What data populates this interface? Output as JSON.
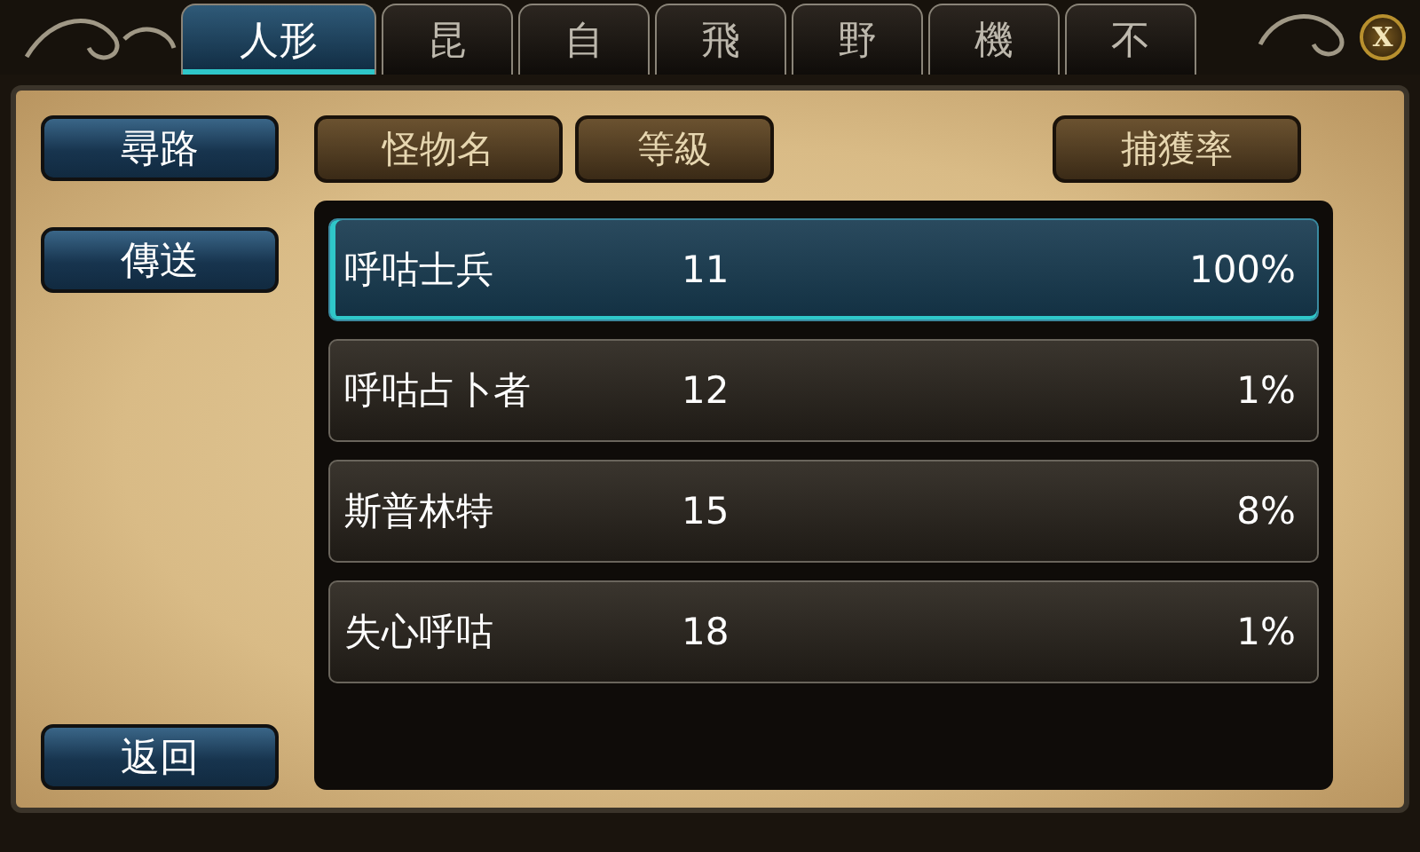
{
  "tabs": [
    {
      "label": "人形",
      "selected": true
    },
    {
      "label": "昆",
      "selected": false
    },
    {
      "label": "自",
      "selected": false
    },
    {
      "label": "飛",
      "selected": false
    },
    {
      "label": "野",
      "selected": false
    },
    {
      "label": "機",
      "selected": false
    },
    {
      "label": "不",
      "selected": false
    }
  ],
  "close_button": "X",
  "side_buttons": [
    "尋路",
    "傳送"
  ],
  "back_button": "返回",
  "columns": [
    "怪物名",
    "等級",
    "捕獲率"
  ],
  "rows": [
    {
      "name": "呼咕士兵",
      "level": "11",
      "rate": "100%",
      "selected": true
    },
    {
      "name": "呼咕占卜者",
      "level": "12",
      "rate": "1%",
      "selected": false
    },
    {
      "name": "斯普林特",
      "level": "15",
      "rate": "8%",
      "selected": false
    },
    {
      "name": "失心呼咕",
      "level": "18",
      "rate": "1%",
      "selected": false
    }
  ]
}
